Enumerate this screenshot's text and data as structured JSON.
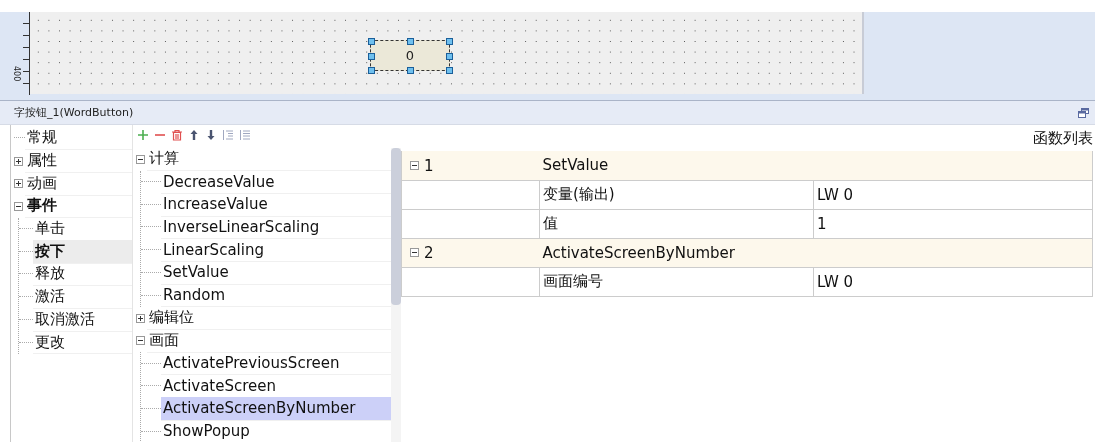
{
  "canvas": {
    "ruler_label": "400",
    "widgets": [
      {
        "label": "0",
        "selected": true
      }
    ]
  },
  "panel": {
    "title": "字按钮_1(WordButton)"
  },
  "category_tree": [
    {
      "label": "常规"
    },
    {
      "label": "属性",
      "expanded": false
    },
    {
      "label": "动画",
      "expanded": false
    },
    {
      "label": "事件",
      "expanded": true,
      "emphasized": true,
      "children": [
        {
          "label": "单击",
          "selected": false
        },
        {
          "label": "按下",
          "selected": true
        },
        {
          "label": "释放",
          "selected": false
        },
        {
          "label": "激活",
          "selected": false
        },
        {
          "label": "取消激活",
          "selected": false
        },
        {
          "label": "更改",
          "selected": false
        }
      ]
    }
  ],
  "toolbar": [
    {
      "kind": "add"
    },
    {
      "kind": "remove"
    },
    {
      "kind": "delete"
    },
    {
      "kind": "up"
    },
    {
      "kind": "down"
    },
    {
      "kind": "indent"
    },
    {
      "kind": "outdent"
    }
  ],
  "function_tree": [
    {
      "label": "计算",
      "expanded": true,
      "children": [
        {
          "label": "DecreaseValue",
          "selected": false
        },
        {
          "label": "IncreaseValue",
          "selected": false
        },
        {
          "label": "InverseLinearScaling",
          "selected": false
        },
        {
          "label": "LinearScaling",
          "selected": false
        },
        {
          "label": "SetValue",
          "selected": false
        },
        {
          "label": "Random",
          "selected": false
        }
      ]
    },
    {
      "label": "编辑位",
      "expanded": false
    },
    {
      "label": "画面",
      "expanded": true,
      "children": [
        {
          "label": "ActivatePreviousScreen",
          "selected": false
        },
        {
          "label": "ActivateScreen",
          "selected": false
        },
        {
          "label": "ActivateScreenByNumber",
          "selected": true
        },
        {
          "label": "ShowPopup",
          "selected": false
        }
      ]
    }
  ],
  "function_list": {
    "title": "函数列表",
    "rows": [
      {
        "kind": "function",
        "number": "1",
        "name": "SetValue",
        "expanded": true
      },
      {
        "kind": "param",
        "name": "变量(输出)",
        "value": "LW 0"
      },
      {
        "kind": "param",
        "name": "值",
        "value": "1"
      },
      {
        "kind": "function",
        "number": "2",
        "name": "ActivateScreenByNumber",
        "expanded": true
      },
      {
        "kind": "param",
        "name": "画面编号",
        "value": "LW 0"
      }
    ]
  }
}
